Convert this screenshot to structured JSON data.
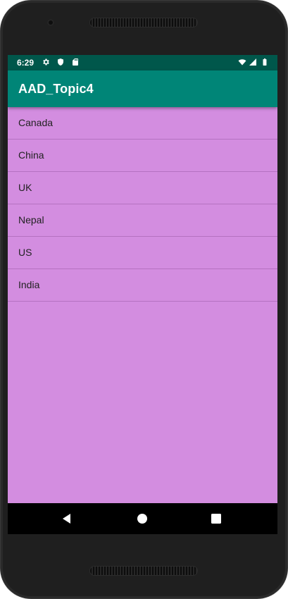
{
  "status_bar": {
    "time": "6:29",
    "left_icons": [
      "gear-icon",
      "shield-icon",
      "sd-card-icon"
    ],
    "right_icons": [
      "wifi-icon",
      "cell-signal-icon",
      "battery-icon"
    ]
  },
  "app_bar": {
    "title": "AAD_Topic4"
  },
  "list": {
    "items": [
      "Canada",
      "China",
      "UK",
      "Nepal",
      "US",
      "India"
    ]
  },
  "nav_bar": {
    "buttons": [
      "back-icon",
      "home-icon",
      "recents-icon"
    ]
  },
  "colors": {
    "status_bar": "#00574b",
    "app_bar": "#008577",
    "list_background": "#d38de0",
    "divider": "#b572c1",
    "nav_bar": "#000000"
  }
}
